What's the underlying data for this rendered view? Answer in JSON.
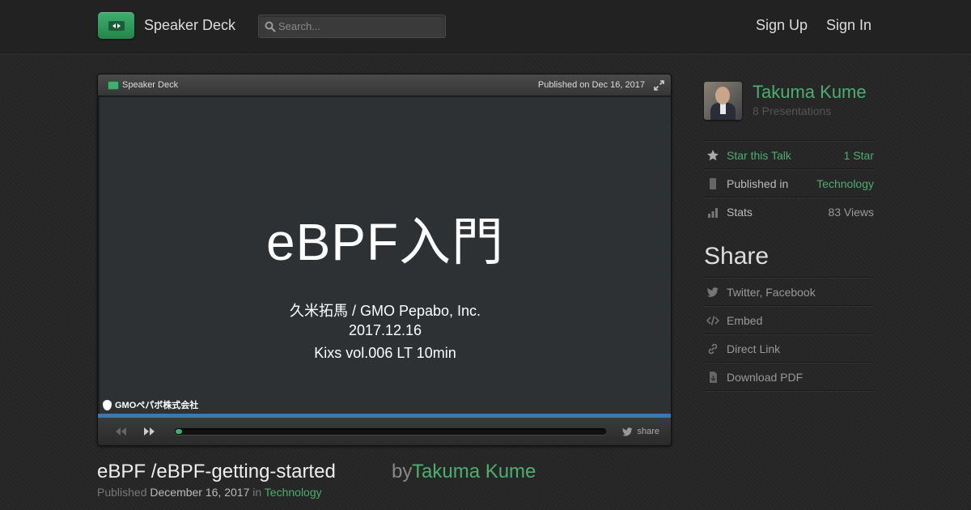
{
  "header": {
    "brand": "Speaker Deck",
    "search_placeholder": "Search...",
    "sign_up": "Sign Up",
    "sign_in": "Sign In",
    "logo_color": "#3fae6f"
  },
  "player": {
    "brand": "Speaker Deck",
    "published": "Published on Dec 16, 2017",
    "slide": {
      "title": "eBPF入門",
      "lines": [
        "久米拓馬 / GMO Pepabo, Inc.",
        "2017.12.16",
        "Kixs vol.006 LT 10min"
      ],
      "footer_logo": "GMOペパボ株式会社"
    },
    "progress": 0.01,
    "share_label": "share",
    "progress_color": "#3b78b0"
  },
  "talk": {
    "title": "eBPF      /eBPF-getting-started",
    "by": "by",
    "author": "Takuma Kume",
    "published_label": "Published",
    "date": "December 16, 2017",
    "in_label": "in",
    "category": "Technology"
  },
  "sidebar": {
    "author_name": "Takuma Kume",
    "presentations": "8 Presentations",
    "stats": [
      {
        "icon": "star-icon",
        "label": "Star this Talk",
        "value": "1 Star"
      },
      {
        "icon": "bookmark-icon",
        "label": "Published in",
        "value": "Technology"
      },
      {
        "icon": "bar-chart-icon",
        "label": "Stats",
        "value": "83 Views"
      }
    ],
    "share_title": "Share",
    "share_items": [
      {
        "icon": "twitter-icon",
        "label": "Twitter, Facebook"
      },
      {
        "icon": "code-icon",
        "label": "Embed"
      },
      {
        "icon": "link-icon",
        "label": "Direct Link"
      },
      {
        "icon": "download-icon",
        "label": "Download PDF"
      }
    ],
    "accent_color": "#4cae6f"
  }
}
